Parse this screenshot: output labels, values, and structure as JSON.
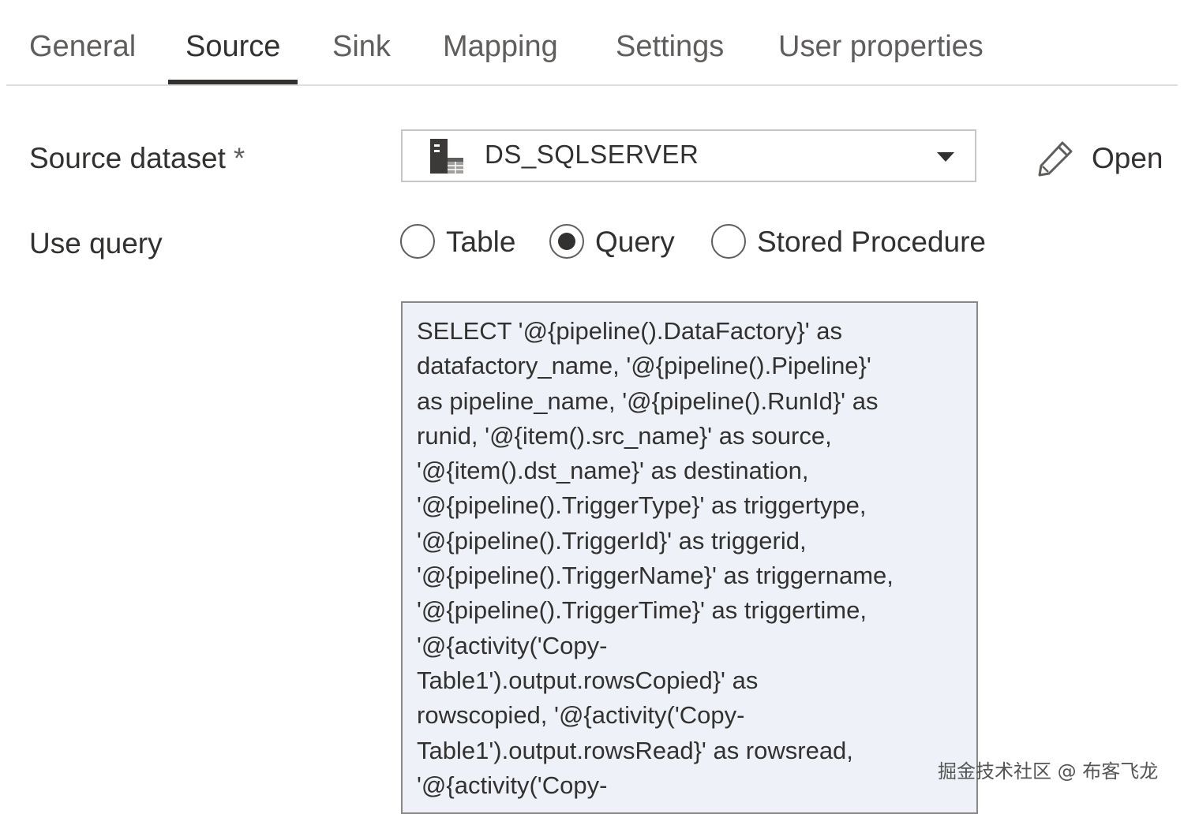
{
  "tabs": [
    {
      "label": "General"
    },
    {
      "label": "Source"
    },
    {
      "label": "Sink"
    },
    {
      "label": "Mapping"
    },
    {
      "label": "Settings"
    },
    {
      "label": "User properties"
    }
  ],
  "active_tab": "Source",
  "form": {
    "source_dataset_label": "Source dataset",
    "required_marker": "*",
    "dataset_value": "DS_SQLSERVER",
    "dataset_icon": "sql-database-icon",
    "open_label": "Open",
    "open_icon": "pencil-icon",
    "use_query_label": "Use query",
    "options": [
      {
        "label": "Table",
        "selected": false
      },
      {
        "label": "Query",
        "selected": true
      },
      {
        "label": "Stored Procedure",
        "selected": false
      }
    ],
    "query_text": "SELECT '@{pipeline().DataFactory}' as\ndatafactory_name, '@{pipeline().Pipeline}'\nas pipeline_name, '@{pipeline().RunId}' as\nrunid, '@{item().src_name}' as source,\n'@{item().dst_name}' as destination,\n'@{pipeline().TriggerType}' as triggertype,\n'@{pipeline().TriggerId}' as triggerid,\n'@{pipeline().TriggerName}' as triggername,\n'@{pipeline().TriggerTime}' as triggertime,\n'@{activity('Copy-\nTable1').output.rowsCopied}' as\nrowscopied, '@{activity('Copy-\nTable1').output.rowsRead}' as rowsread,\n'@{activity('Copy-"
  },
  "watermark": "掘金技术社区 @ 布客飞龙",
  "colors": {
    "text": "#323130",
    "muted": "#605e5c",
    "query_background": "#eef2f8",
    "border": "#c8c6c4"
  }
}
